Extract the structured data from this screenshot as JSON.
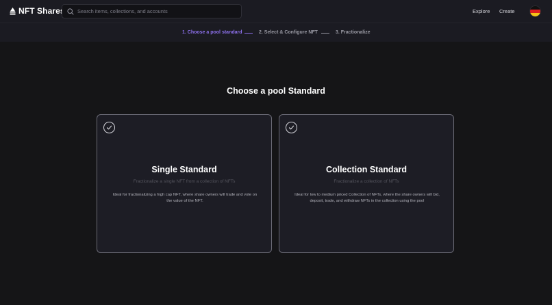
{
  "brand": {
    "name": "NFT Shares"
  },
  "search": {
    "placeholder": "Search items, collections, and accounts"
  },
  "nav": {
    "explore": "Explore",
    "create": "Create"
  },
  "steps": [
    {
      "label": "1. Choose a pool standard",
      "active": true
    },
    {
      "label": "2. Select & Configure NFT",
      "active": false
    },
    {
      "label": "3. Fractionalize",
      "active": false
    }
  ],
  "main": {
    "heading": "Choose a pool Standard",
    "cards": [
      {
        "title": "Single Standard",
        "subtitle": "Fractionalize a single NFT from a collection of NFTs",
        "description": "Ideal for fractionalizing a high cap NFT, where share owners will trade and vote on the value of the NFT."
      },
      {
        "title": "Collection Standard",
        "subtitle": "Fractionalize a collection of NFTs",
        "description": "Ideal for low to medium priced Collection of NFTs, where the share owners will bid, deposit, trade, and withdraw NFTs in the collection using the pool"
      }
    ]
  },
  "colors": {
    "accent": "#8f72f0",
    "background": "#151517",
    "header": "#1b1b22"
  },
  "icons": {
    "brand": "nft-shares-logo-icon",
    "search": "search-icon",
    "card_check": "check-circle-icon"
  }
}
